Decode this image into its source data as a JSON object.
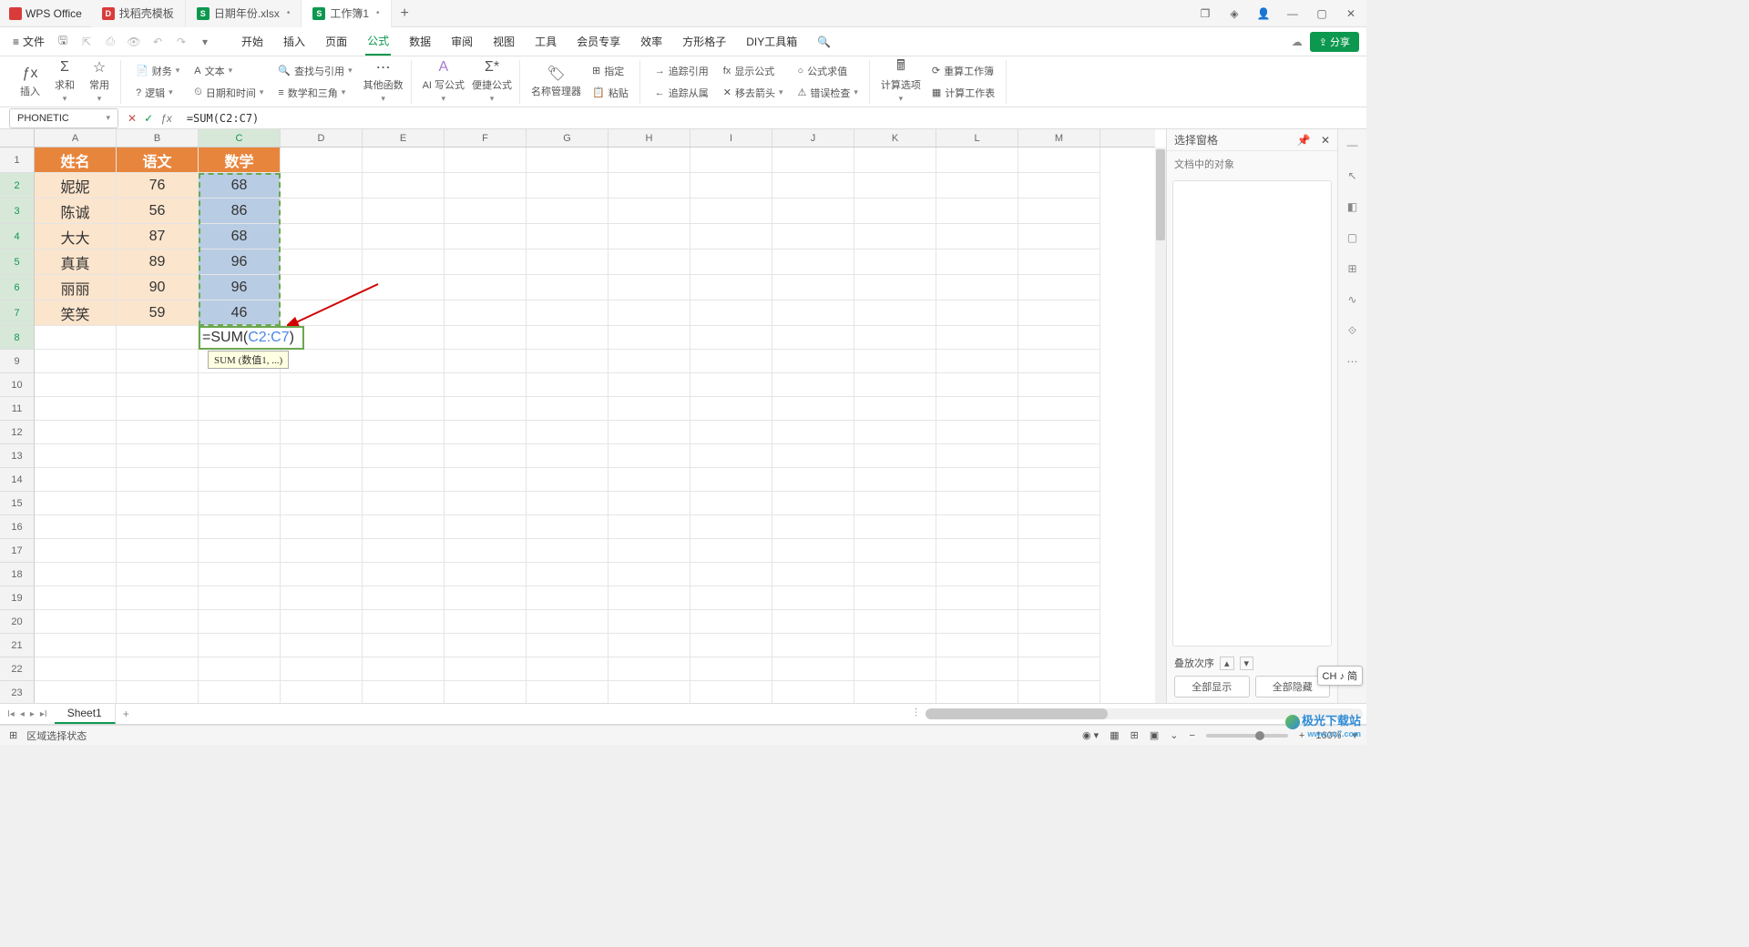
{
  "app": {
    "name": "WPS Office"
  },
  "tabs": [
    {
      "label": "找稻壳模板",
      "iconColor": "red"
    },
    {
      "label": "日期年份.xlsx",
      "iconColor": "green"
    },
    {
      "label": "工作簿1",
      "iconColor": "green",
      "active": true,
      "dirty": "•"
    }
  ],
  "menubar": {
    "file": "文件",
    "items": [
      "开始",
      "插入",
      "页面",
      "公式",
      "数据",
      "审阅",
      "视图",
      "工具",
      "会员专享",
      "效率",
      "方形格子",
      "DIY工具箱"
    ],
    "activeIndex": 3
  },
  "ribbon": {
    "insert": "插入",
    "sum": "求和",
    "common": "常用",
    "finance": "财务",
    "text": "文本",
    "lookup": "查找与引用",
    "logic": "逻辑",
    "datetime": "日期和时间",
    "math": "数学和三角",
    "other": "其他函数",
    "ai": "AI 写公式",
    "freq": "便捷公式",
    "nameMgr": "名称管理器",
    "paste": "粘贴",
    "assign": "指定",
    "traceRef": "追踪引用",
    "showFormula": "显示公式",
    "formulaEval": "公式求值",
    "traceDep": "追踪从属",
    "removeArrow": "移去箭头",
    "errCheck": "错误检查",
    "calcOpts": "计算选项",
    "recalcSheet": "重算工作簿",
    "calcSheet": "计算工作表"
  },
  "formulaBar": {
    "nameBox": "PHONETIC",
    "formula": "=SUM(C2:C7)"
  },
  "columns": [
    "A",
    "B",
    "C",
    "D",
    "E",
    "F",
    "G",
    "H",
    "I",
    "J",
    "K",
    "L",
    "M"
  ],
  "sheet": {
    "headers": [
      "姓名",
      "语文",
      "数学"
    ],
    "rows": [
      {
        "name": "妮妮",
        "chinese": "76",
        "math": "68"
      },
      {
        "name": "陈诚",
        "chinese": "56",
        "math": "86"
      },
      {
        "name": "大大",
        "chinese": "87",
        "math": "68"
      },
      {
        "name": "真真",
        "chinese": "89",
        "math": "96"
      },
      {
        "name": "丽丽",
        "chinese": "90",
        "math": "96"
      },
      {
        "name": "笑笑",
        "chinese": "59",
        "math": "46"
      }
    ],
    "editing": {
      "prefix": "=SUM(",
      "ref": "C2:C7",
      "suffix": ")"
    },
    "tooltip": "SUM (数值1, ...)"
  },
  "taskPane": {
    "title": "选择窗格",
    "subtitle": "文档中的对象",
    "stackOrder": "叠放次序",
    "showAll": "全部显示",
    "hideAll": "全部隐藏"
  },
  "sheetTabs": {
    "sheet1": "Sheet1"
  },
  "statusbar": {
    "mode": "区域选择状态",
    "zoom": "160%"
  },
  "ime": "CH ♪ 简",
  "watermark": {
    "main": "极光下载站",
    "sub": "www.xz7.com"
  }
}
